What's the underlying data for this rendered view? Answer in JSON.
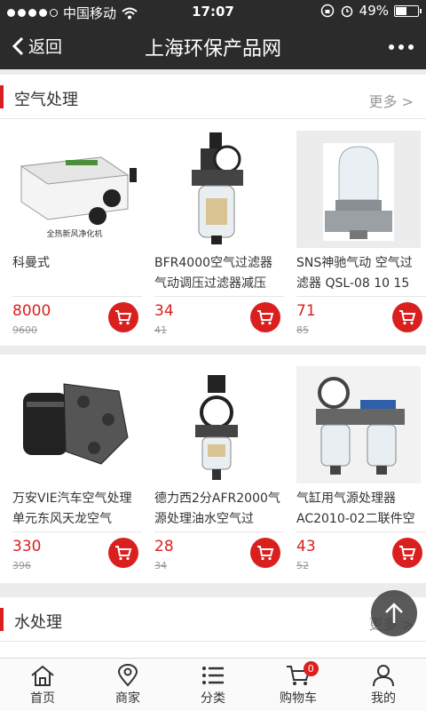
{
  "status_bar": {
    "carrier": "中国移动",
    "time": "17:07",
    "battery_text": "49%",
    "battery_level": 0.49
  },
  "nav": {
    "back_label": "返回",
    "title": "上海环保产品网"
  },
  "sections": [
    {
      "title": "空气处理",
      "more_label": "更多",
      "rows": [
        [
          {
            "name": "科曼式",
            "image_caption": "全热新风净化机",
            "price": "8000",
            "original_price": "9600"
          },
          {
            "name": "BFR4000空气过滤器气动调压过滤器减压",
            "price": "34",
            "original_price": "41"
          },
          {
            "name": "SNS神驰气动 空气过滤器 QSL-08 10 15",
            "price": "71",
            "original_price": "85"
          }
        ],
        [
          {
            "name": "万安VIE汽车空气处理单元东风天龙空气",
            "price": "330",
            "original_price": "396"
          },
          {
            "name": "德力西2分AFR2000气源处理油水空气过",
            "price": "28",
            "original_price": "34"
          },
          {
            "name": "气缸用气源处理器AC2010-02二联件空",
            "price": "43",
            "original_price": "52"
          }
        ]
      ]
    },
    {
      "title": "水处理",
      "more_label": "更多"
    }
  ],
  "tabbar": [
    {
      "label": "首页",
      "icon": "home-icon"
    },
    {
      "label": "商家",
      "icon": "location-pin-icon"
    },
    {
      "label": "分类",
      "icon": "list-icon"
    },
    {
      "label": "购物车",
      "icon": "cart-icon",
      "badge": "0"
    },
    {
      "label": "我的",
      "icon": "user-icon"
    }
  ],
  "colors": {
    "accent": "#d9201f",
    "header_bg": "#2b2b2b"
  }
}
